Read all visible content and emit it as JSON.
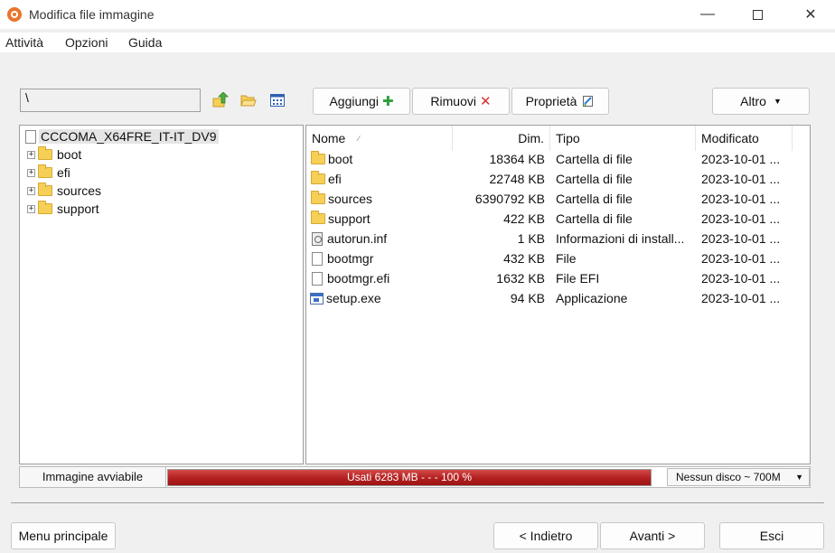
{
  "window": {
    "title": "Modifica file immagine"
  },
  "menu": [
    "Attività",
    "Opzioni",
    "Guida"
  ],
  "toolbar": {
    "path": "\\",
    "add_label": "Aggiungi",
    "remove_label": "Rimuovi",
    "properties_label": "Proprietà",
    "other_label": "Altro"
  },
  "tree": {
    "root": "CCCOMA_X64FRE_IT-IT_DV9",
    "children": [
      "boot",
      "efi",
      "sources",
      "support"
    ]
  },
  "list": {
    "columns": {
      "name": "Nome",
      "size": "Dim.",
      "type": "Tipo",
      "modified": "Modificato"
    },
    "rows": [
      {
        "name": "boot",
        "size": "18364 KB",
        "type": "Cartella di file",
        "modified": "2023-10-01 ...",
        "icon": "folder-icon"
      },
      {
        "name": "efi",
        "size": "22748 KB",
        "type": "Cartella di file",
        "modified": "2023-10-01 ...",
        "icon": "folder-icon"
      },
      {
        "name": "sources",
        "size": "6390792 KB",
        "type": "Cartella di file",
        "modified": "2023-10-01 ...",
        "icon": "folder-icon"
      },
      {
        "name": "support",
        "size": "422 KB",
        "type": "Cartella di file",
        "modified": "2023-10-01 ...",
        "icon": "folder-icon"
      },
      {
        "name": "autorun.inf",
        "size": "1 KB",
        "type": "Informazioni di install...",
        "modified": "2023-10-01 ...",
        "icon": "settings-file-icon"
      },
      {
        "name": "bootmgr",
        "size": "432 KB",
        "type": "File",
        "modified": "2023-10-01 ...",
        "icon": "file-icon"
      },
      {
        "name": "bootmgr.efi",
        "size": "1632 KB",
        "type": "File EFI",
        "modified": "2023-10-01 ...",
        "icon": "file-icon"
      },
      {
        "name": "setup.exe",
        "size": "94 KB",
        "type": "Applicazione",
        "modified": "2023-10-01 ...",
        "icon": "application-icon"
      }
    ]
  },
  "status": {
    "image_type": "Immagine avviabile",
    "usage_text": "Usati  6283 MB  - - -  100 %",
    "usage_percent": 100,
    "disc": "Nessun disco ~ 700M"
  },
  "footer": {
    "main_menu_label": "Menu principale",
    "back_label": "< Indietro",
    "next_label": "Avanti >",
    "exit_label": "Esci"
  },
  "colors": {
    "progress": "#b31f1f",
    "folder": "#f6cf56",
    "add_icon": "#2e9e3a",
    "remove_icon": "#d93030"
  }
}
